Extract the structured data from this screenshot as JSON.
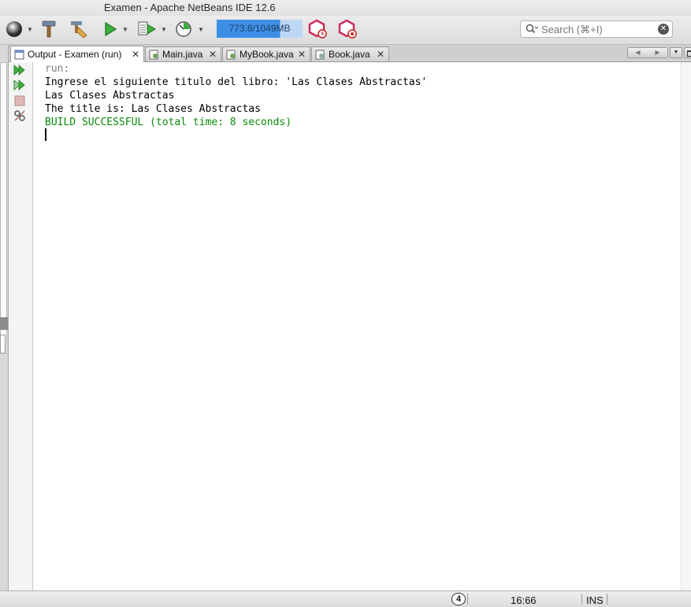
{
  "window": {
    "title": "Examen - Apache NetBeans IDE 12.6"
  },
  "toolbar": {
    "buttons": [
      "globe-icon",
      "hammer-icon",
      "clean-build-icon",
      "run-icon",
      "debug-icon",
      "profile-icon",
      "profile-snapshot-icon",
      "profile-gc-icon"
    ],
    "memory_label": "773.8/1049MB",
    "memory_used_fraction": 0.737,
    "search_placeholder": "Search (⌘+I)"
  },
  "tabs": [
    {
      "label": "Output - Examen (run)",
      "active": true
    },
    {
      "label": "Main.java",
      "active": false
    },
    {
      "label": "MyBook.java",
      "active": false
    },
    {
      "label": "Book.java",
      "active": false
    }
  ],
  "output": {
    "lines": [
      {
        "text": "run:",
        "color": "#808080"
      },
      {
        "text": "Ingrese el siguiente titulo del libro: 'Las Clases Abstractas'",
        "color": "#000000"
      },
      {
        "text": "Las Clases Abstractas",
        "color": "#000000"
      },
      {
        "text": "The title is: Las Clases Abstractas",
        "color": "#000000"
      },
      {
        "text": "BUILD SUCCESSFUL (total time: 8 seconds)",
        "color": "#0a8a0a"
      }
    ]
  },
  "statusbar": {
    "notifications": "4",
    "position": "16:66",
    "insert_mode": "INS"
  }
}
